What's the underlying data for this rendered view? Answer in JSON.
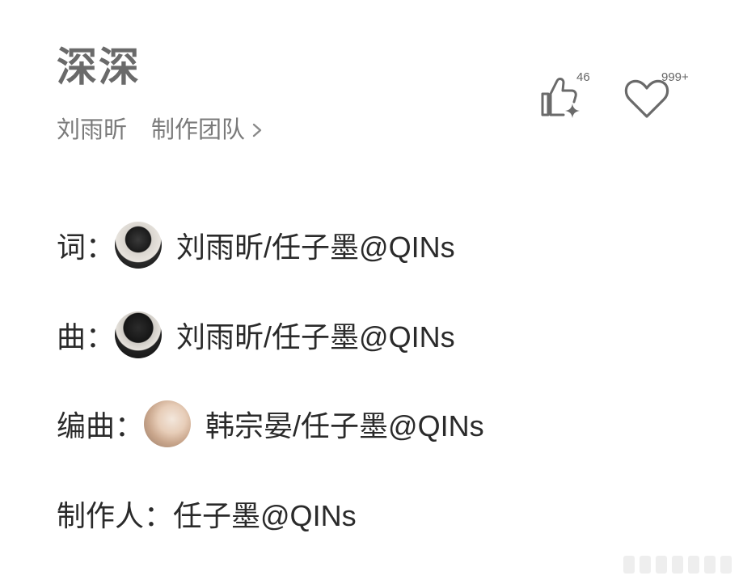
{
  "song": {
    "title": "深深",
    "artist": "刘雨昕",
    "team_label": "制作团队"
  },
  "actions": {
    "like_count": "46",
    "favorite_count": "999+"
  },
  "credits": [
    {
      "role": "词：",
      "names": "刘雨昕/任子墨@QINs",
      "avatar": "avatar-dark"
    },
    {
      "role": "曲：",
      "names": "刘雨昕/任子墨@QINs",
      "avatar": "avatar-dark"
    },
    {
      "role": "编曲：",
      "names": "韩宗晏/任子墨@QINs",
      "avatar": "avatar-light"
    },
    {
      "role": "制作人：",
      "names": "任子墨@QINs"
    }
  ],
  "icons": {
    "like": "thumbs-up-sparkle-icon",
    "favorite": "heart-icon",
    "chevron": "chevron-right-icon"
  },
  "colors": {
    "title": "#6a6a6a",
    "meta": "#7a7a7a",
    "body_text": "#2a2a2a",
    "icon_stroke": "#6a6a6a"
  }
}
